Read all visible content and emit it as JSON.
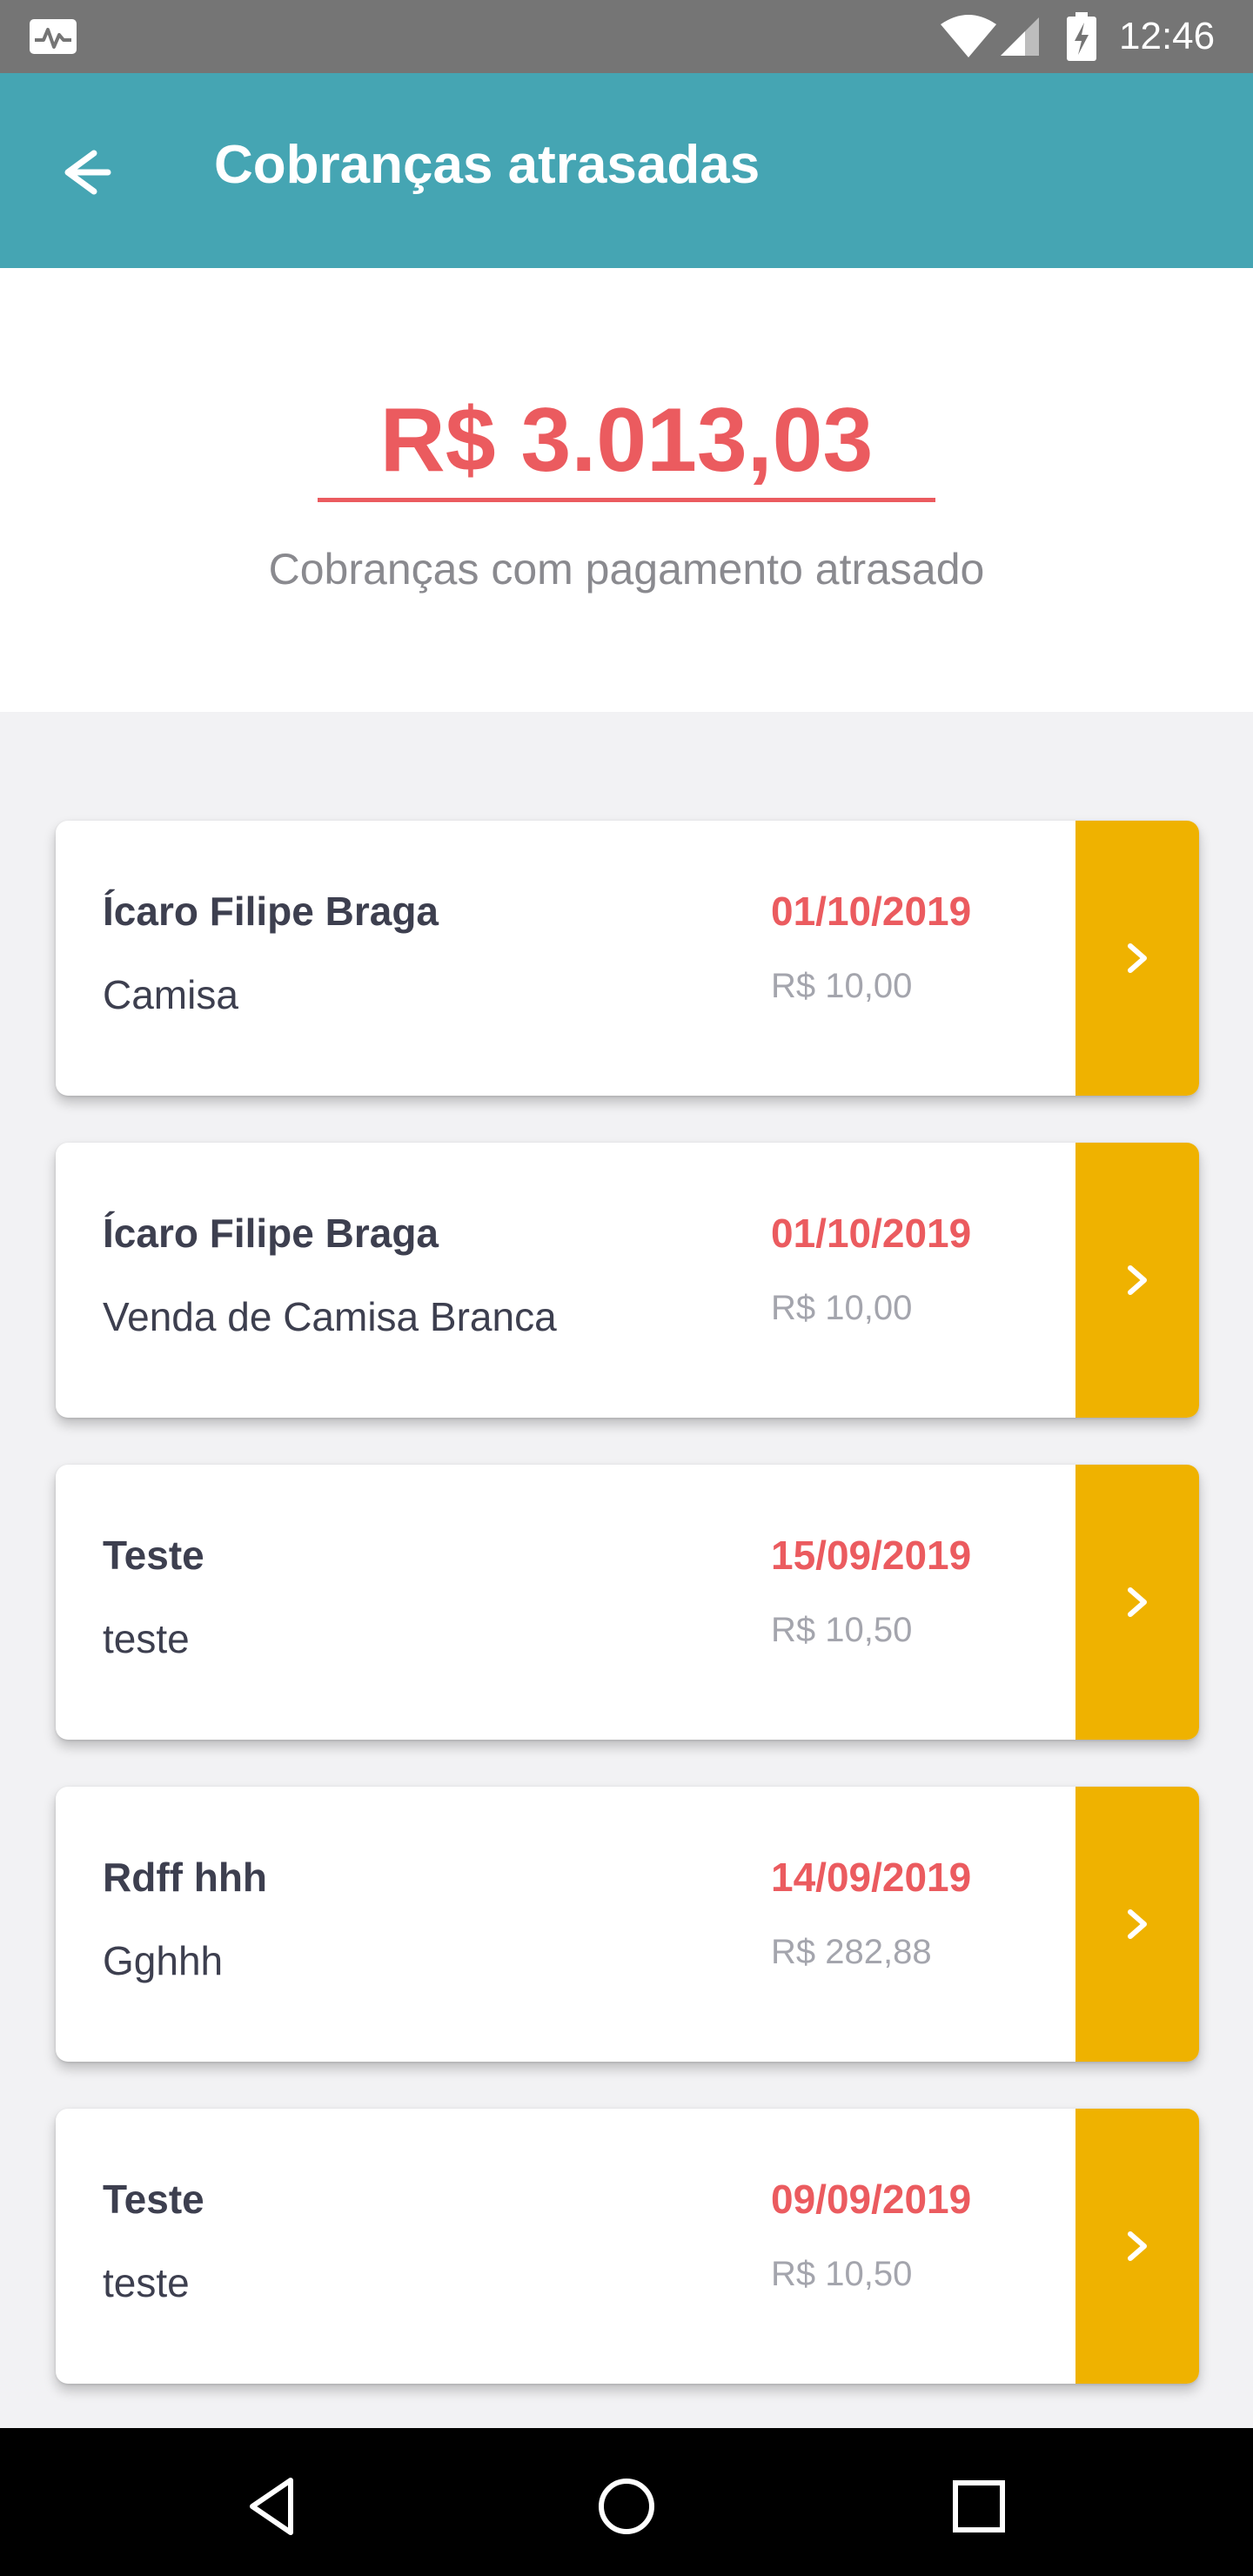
{
  "status_bar": {
    "time": "12:46",
    "icons": [
      "activity-icon",
      "wifi-icon",
      "signal-icon",
      "battery-charging-icon"
    ]
  },
  "app_bar": {
    "title": "Cobranças atrasadas",
    "back_icon": "arrow-left-icon",
    "color": "#45a5b3"
  },
  "summary": {
    "amount": "R$ 3.013,03",
    "subtitle": "Cobranças com pagamento atrasado",
    "amount_color": "#eb5b5f"
  },
  "charges": [
    {
      "name": "Ícaro Filipe Braga",
      "description": "Camisa",
      "date": "01/10/2019",
      "value": "R$ 10,00"
    },
    {
      "name": "Ícaro Filipe Braga",
      "description": "Venda de Camisa Branca",
      "date": "01/10/2019",
      "value": "R$ 10,00"
    },
    {
      "name": "Teste",
      "description": "teste",
      "date": "15/09/2019",
      "value": "R$ 10,50"
    },
    {
      "name": "Rdff hhh",
      "description": "Gghhh",
      "date": "14/09/2019",
      "value": "R$ 282,88"
    },
    {
      "name": "Teste",
      "description": "teste",
      "date": "09/09/2019",
      "value": "R$ 10,50"
    }
  ],
  "colors": {
    "accent_yellow": "#efb200",
    "date_red": "#eb5b5f",
    "text_dark": "#3d3f4f",
    "text_muted": "#a4a5ad"
  },
  "nav_bar": {
    "icons": [
      "back-triangle-icon",
      "home-circle-icon",
      "recents-square-icon"
    ]
  }
}
